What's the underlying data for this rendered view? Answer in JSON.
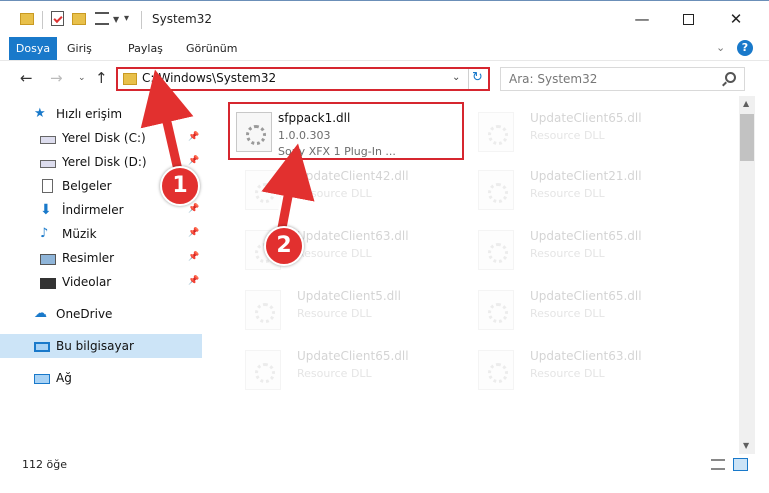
{
  "window": {
    "title": "System32"
  },
  "ribbon": {
    "tabs": [
      "Dosya",
      "Giriş",
      "Paylaş",
      "Görünüm"
    ],
    "help": "?"
  },
  "address_bar": {
    "path": "C:\\Windows\\System32",
    "search_placeholder": "Ara: System32"
  },
  "nav_pane": {
    "quick_access": "Hızlı erişim",
    "items": [
      "Yerel Disk (C:)",
      "Yerel Disk (D:)",
      "Belgeler",
      "İndirmeler",
      "Müzik",
      "Resimler",
      "Videolar"
    ],
    "onedrive": "OneDrive",
    "this_pc": "Bu bilgisayar",
    "network": "Ağ"
  },
  "files": [
    {
      "name": "sfppack1.dll",
      "line2": "1.0.0.303",
      "line3": "Sony XFX 1 Plug-In ..."
    },
    {
      "name": "UpdateClient65.dll",
      "line2": "Resource DLL"
    },
    {
      "name": "UpdateClient42.dll",
      "line2": "Resource DLL"
    },
    {
      "name": "UpdateClient21.dll",
      "line2": "Resource DLL"
    },
    {
      "name": "UpdateClient63.dll",
      "line2": "Resource DLL"
    },
    {
      "name": "UpdateClient65.dll",
      "line2": "Resource DLL"
    },
    {
      "name": "UpdateClient5.dll",
      "line2": "Resource DLL"
    },
    {
      "name": "UpdateClient65.dll",
      "line2": "Resource DLL"
    },
    {
      "name": "UpdateClient65.dll",
      "line2": "Resource DLL"
    },
    {
      "name": "UpdateClient63.dll",
      "line2": "Resource DLL"
    }
  ],
  "status": {
    "item_count": "112 öğe"
  },
  "annotations": {
    "callout_1": "1",
    "callout_2": "2",
    "color": "#e2302f"
  }
}
